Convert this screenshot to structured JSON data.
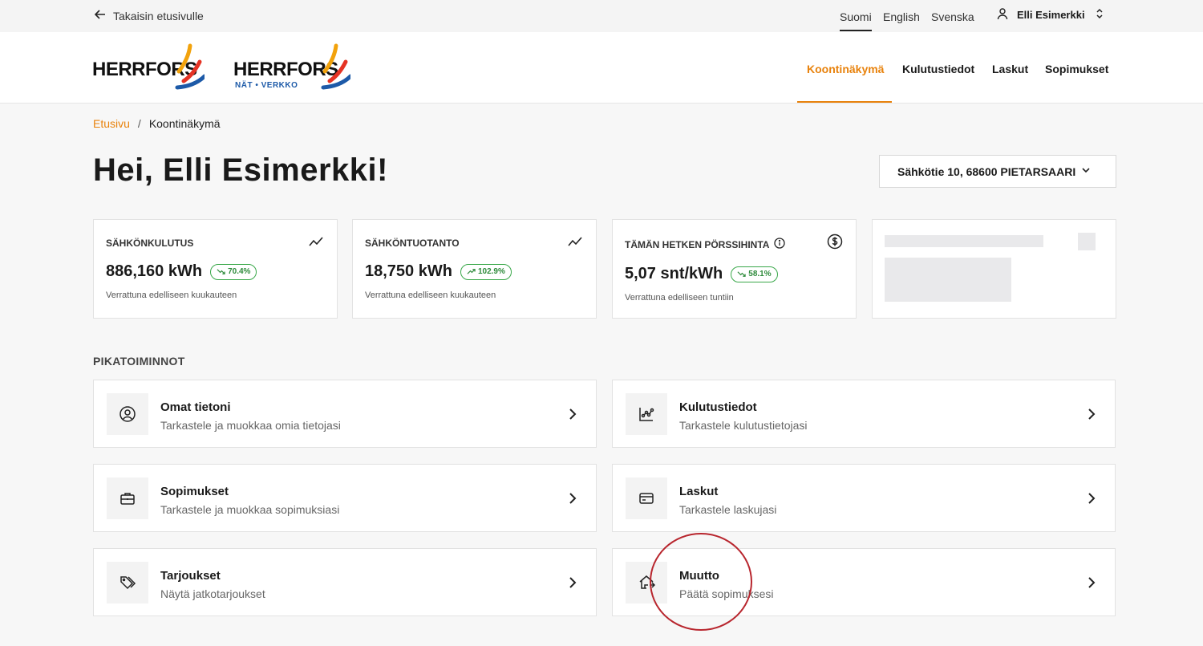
{
  "topbar": {
    "back_label": "Takaisin etusivulle",
    "languages": [
      {
        "label": "Suomi",
        "active": true
      },
      {
        "label": "English",
        "active": false
      },
      {
        "label": "Svenska",
        "active": false
      }
    ],
    "user_name": "Elli Esimerkki"
  },
  "header": {
    "logo1": {
      "text": "HERRFORS"
    },
    "logo2": {
      "text": "HERRFORS",
      "sub": "NÄT • VERKKO"
    },
    "nav": [
      {
        "label": "Koontinäkymä",
        "active": true
      },
      {
        "label": "Kulutustiedot",
        "active": false
      },
      {
        "label": "Laskut",
        "active": false
      },
      {
        "label": "Sopimukset",
        "active": false
      }
    ]
  },
  "breadcrumb": {
    "home": "Etusivu",
    "separator": "/",
    "current": "Koontinäkymä"
  },
  "page_title": "Hei, Elli Esimerkki!",
  "address": {
    "value": "Sähkötie 10, 68600 PIETARSAARI"
  },
  "stats": [
    {
      "label": "SÄHKÖNKULUTUS",
      "value": "886,160 kWh",
      "change": "70.4%",
      "trend": "down",
      "sub": "Verrattuna edelliseen kuukauteen",
      "icon": "trend-line-icon"
    },
    {
      "label": "SÄHKÖNTUOTANTO",
      "value": "18,750 kWh",
      "change": "102.9%",
      "trend": "up",
      "sub": "Verrattuna edelliseen kuukauteen",
      "icon": "trend-line-icon"
    },
    {
      "label": "TÄMÄN HETKEN PÖRSSIHINTA",
      "value": "5,07 snt/kWh",
      "change": "58.1%",
      "trend": "down",
      "sub": "Verrattuna edelliseen tuntiin",
      "icon": "dollar-circle-icon"
    }
  ],
  "quick_actions": {
    "title": "PIKATOIMINNOT",
    "items": [
      {
        "title": "Omat tietoni",
        "sub": "Tarkastele ja muokkaa omia tietojasi",
        "icon": "user-circle-icon"
      },
      {
        "title": "Kulutustiedot",
        "sub": "Tarkastele kulutustietojasi",
        "icon": "chart-icon"
      },
      {
        "title": "Sopimukset",
        "sub": "Tarkastele ja muokkaa sopimuksiasi",
        "icon": "briefcase-icon"
      },
      {
        "title": "Laskut",
        "sub": "Tarkastele laskujasi",
        "icon": "credit-card-icon"
      },
      {
        "title": "Tarjoukset",
        "sub": "Näytä jatkotarjoukset",
        "icon": "tags-icon"
      },
      {
        "title": "Muutto",
        "sub": "Päätä sopimuksesi",
        "icon": "house-move-icon"
      }
    ]
  },
  "colors": {
    "accent": "#e8820c",
    "positive": "#2d8a3a",
    "annotation": "#b8262e"
  }
}
